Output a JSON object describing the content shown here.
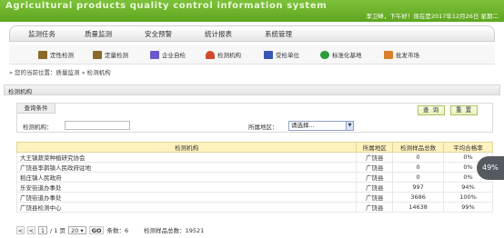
{
  "header": {
    "title": "Agricultural products quality control information system",
    "user_info": "李卫峰，下午好！现在是2017年12月26日 星期二"
  },
  "main_nav": [
    "监测任务",
    "质量监测",
    "安全预警",
    "统计报表",
    "系统管理"
  ],
  "sub_nav": [
    {
      "label": "定性检测",
      "icon": "building-icon",
      "color": "#8a6a2a"
    },
    {
      "label": "定量检测",
      "icon": "building-icon",
      "color": "#8a6a2a"
    },
    {
      "label": "企业自检",
      "icon": "factory-icon",
      "color": "#6a5acd"
    },
    {
      "label": "检测机构",
      "icon": "house-icon",
      "color": "#d24a2a"
    },
    {
      "label": "受检单位",
      "icon": "factory-icon",
      "color": "#3a57b5"
    },
    {
      "label": "标准化基地",
      "icon": "leaf-icon",
      "color": "#2e9b3c"
    },
    {
      "label": "批发市场",
      "icon": "market-icon",
      "color": "#d8802a"
    }
  ],
  "breadcrumb": "» 您的当前位置：质量监测 » 检测机构",
  "section_title": "检测机构",
  "query": {
    "tab_label": "查询条件",
    "search_button": "查 询",
    "reset_button": "重 置",
    "org_label": "检测机构：",
    "org_value": "",
    "region_label": "所属地区：",
    "region_selected": "请选择..."
  },
  "table": {
    "columns": [
      "检测机构",
      "所属地区",
      "检测样品总数",
      "平均合格率"
    ],
    "rows": [
      {
        "name": "大王镇蔬菜种植研究协会",
        "region": "广饶县",
        "samples": "0",
        "rate": "0%"
      },
      {
        "name": "广饶县李鹊镇人民政府驻地",
        "region": "广饶县",
        "samples": "0",
        "rate": "0%"
      },
      {
        "name": "稻庄镇人民政府",
        "region": "广饶县",
        "samples": "0",
        "rate": "0%"
      },
      {
        "name": "乐安街道办事处",
        "region": "广饶县",
        "samples": "997",
        "rate": "94%"
      },
      {
        "name": "广饶街道办事处",
        "region": "广饶县",
        "samples": "3686",
        "rate": "100%"
      },
      {
        "name": "广饶县检测中心",
        "region": "广饶县",
        "samples": "14638",
        "rate": "99%"
      }
    ]
  },
  "pager": {
    "first": "<",
    "prev": "<",
    "page": "1",
    "page_text": "/ 1 页",
    "page_size": "20",
    "go": "GO",
    "count": "条数：6",
    "total": "检测样品总数：19521"
  },
  "badge": "49%"
}
